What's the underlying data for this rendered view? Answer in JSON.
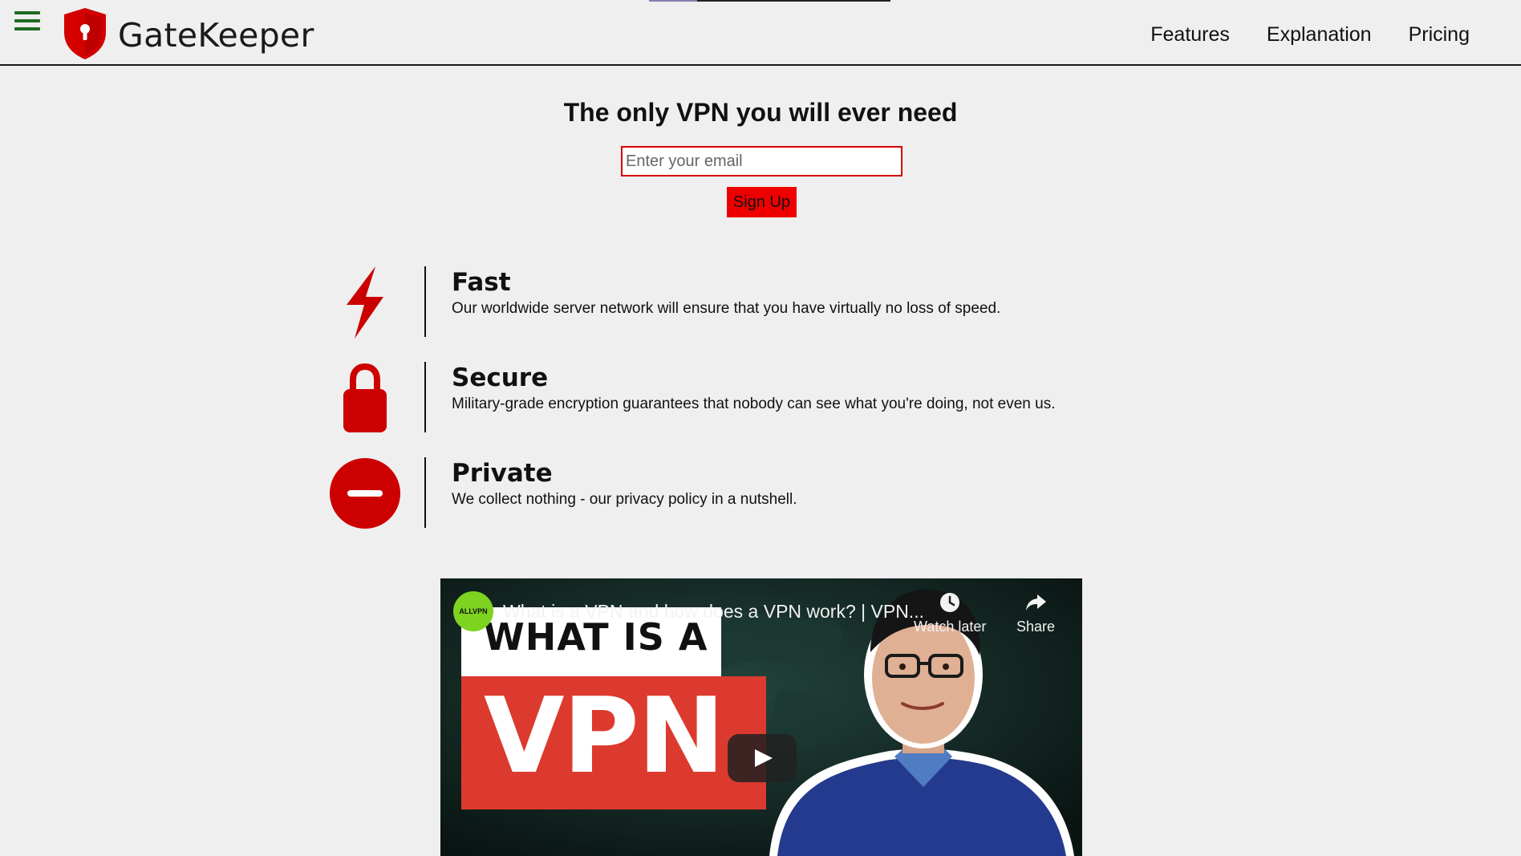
{
  "header": {
    "brand": "GateKeeper",
    "nav": [
      "Features",
      "Explanation",
      "Pricing"
    ]
  },
  "hero": {
    "title": "The only VPN you will ever need",
    "email_placeholder": "Enter your email",
    "signup_label": "Sign Up"
  },
  "features": [
    {
      "icon": "lightning-icon",
      "title": "Fast",
      "description": "Our worldwide server network will ensure that you have virtually no loss of speed."
    },
    {
      "icon": "lock-icon",
      "title": "Secure",
      "description": "Military-grade encryption guarantees that nobody can see what you're doing, not even us."
    },
    {
      "icon": "no-entry-icon",
      "title": "Private",
      "description": "We collect nothing - our privacy policy in a nutshell."
    }
  ],
  "video": {
    "title": "What is a VPN and how does a VPN work? | VPN...",
    "channel": "ALLVPN",
    "watch_later": "Watch later",
    "share": "Share",
    "thumb_line1": "WHAT IS A",
    "thumb_line2": "VPN"
  },
  "colors": {
    "accent": "#d40000",
    "menu_icon": "#1f6b1f",
    "icon_red": "#cc0000"
  }
}
